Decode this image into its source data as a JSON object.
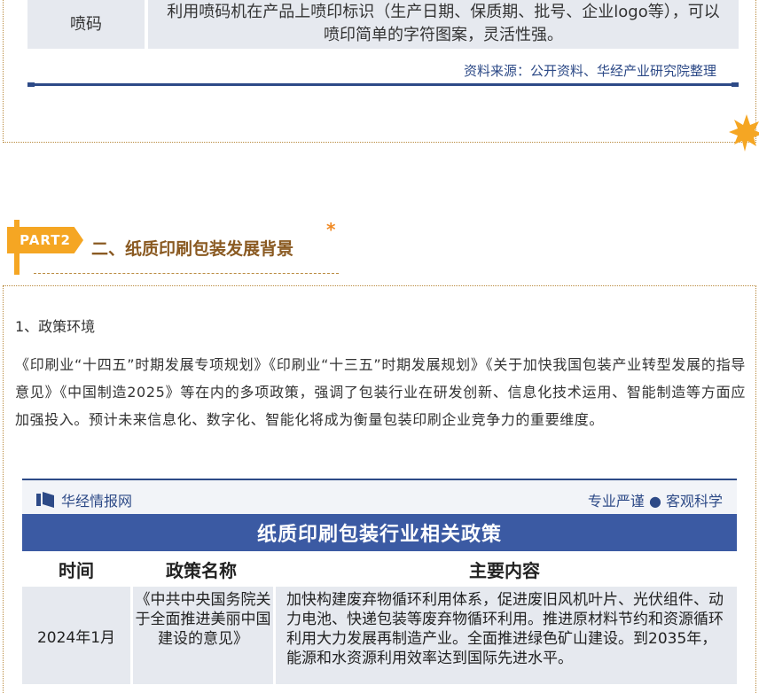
{
  "top_table": {
    "row": {
      "name": "喷码",
      "content": "利用喷码机在产品上喷印标识（生产日期、保质期、批号、企业logo等），可以喷印简单的字符图案，灵活性强。"
    },
    "source": "资料来源：公开资料、华经产业研究院整理"
  },
  "part": {
    "badge": "PART2",
    "title": "二、纸质印刷包装发展背景",
    "star": "*"
  },
  "section": {
    "heading": "1、政策环境",
    "paragraph": "《印刷业“十四五”时期发展专项规划》《印刷业“十三五”时期发展规划》《关于加快我国包装产业转型发展的指导意见》《中国制造2025》等在内的多项政策，强调了包装行业在研发创新、信息化技术运用、智能制造等方面应加强投入。预计未来信息化、数字化、智能化将成为衡量包装印刷企业竞争力的重要维度。"
  },
  "card": {
    "brand": "华经情报网",
    "tagline": "专业严谨 ● 客观科学",
    "title": "纸质印刷包装行业相关政策",
    "columns": [
      "时间",
      "政策名称",
      "主要内容"
    ],
    "rows": [
      {
        "time": "2024年1月",
        "policy": "《中共中央国务院关于全面推进美丽中国建设的意见》",
        "content": "加快构建废弃物循环利用体系，促进废旧风机叶片、光伏组件、动力电池、快递包装等废弃物循环利用。推进原材料节约和资源循环利用大力发展再制造产业。全面推进绿色矿山建设。到2035年，能源和水资源利用效率达到国际先进水平。"
      }
    ]
  },
  "colors": {
    "navy": "#2d4a87",
    "title_bar": "#3b5aa3",
    "cell_bg": "#e6e9ef",
    "accent_orange": "#f5a623",
    "heading_brown": "#8a5a22"
  }
}
